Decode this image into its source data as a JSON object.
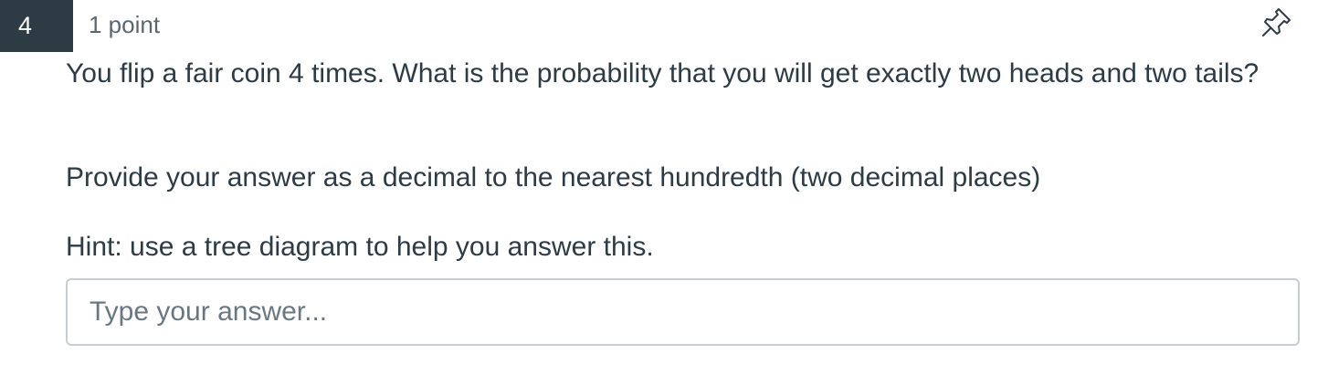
{
  "question": {
    "number": "4",
    "points": "1 point",
    "text": "You flip a fair coin 4 times. What is the probability that you will get exactly two heads and two tails?",
    "instruction": "Provide your answer as a decimal to the nearest hundredth (two decimal places)",
    "hint": "Hint: use a tree diagram to help you answer this."
  },
  "answer": {
    "value": "",
    "placeholder": "Type your answer..."
  },
  "icons": {
    "pin": "pin-icon"
  },
  "colors": {
    "number_badge_bg": "#2d3b45",
    "text": "#2d3b45",
    "muted_text": "#5b6770",
    "input_border": "#c7cdd1"
  }
}
